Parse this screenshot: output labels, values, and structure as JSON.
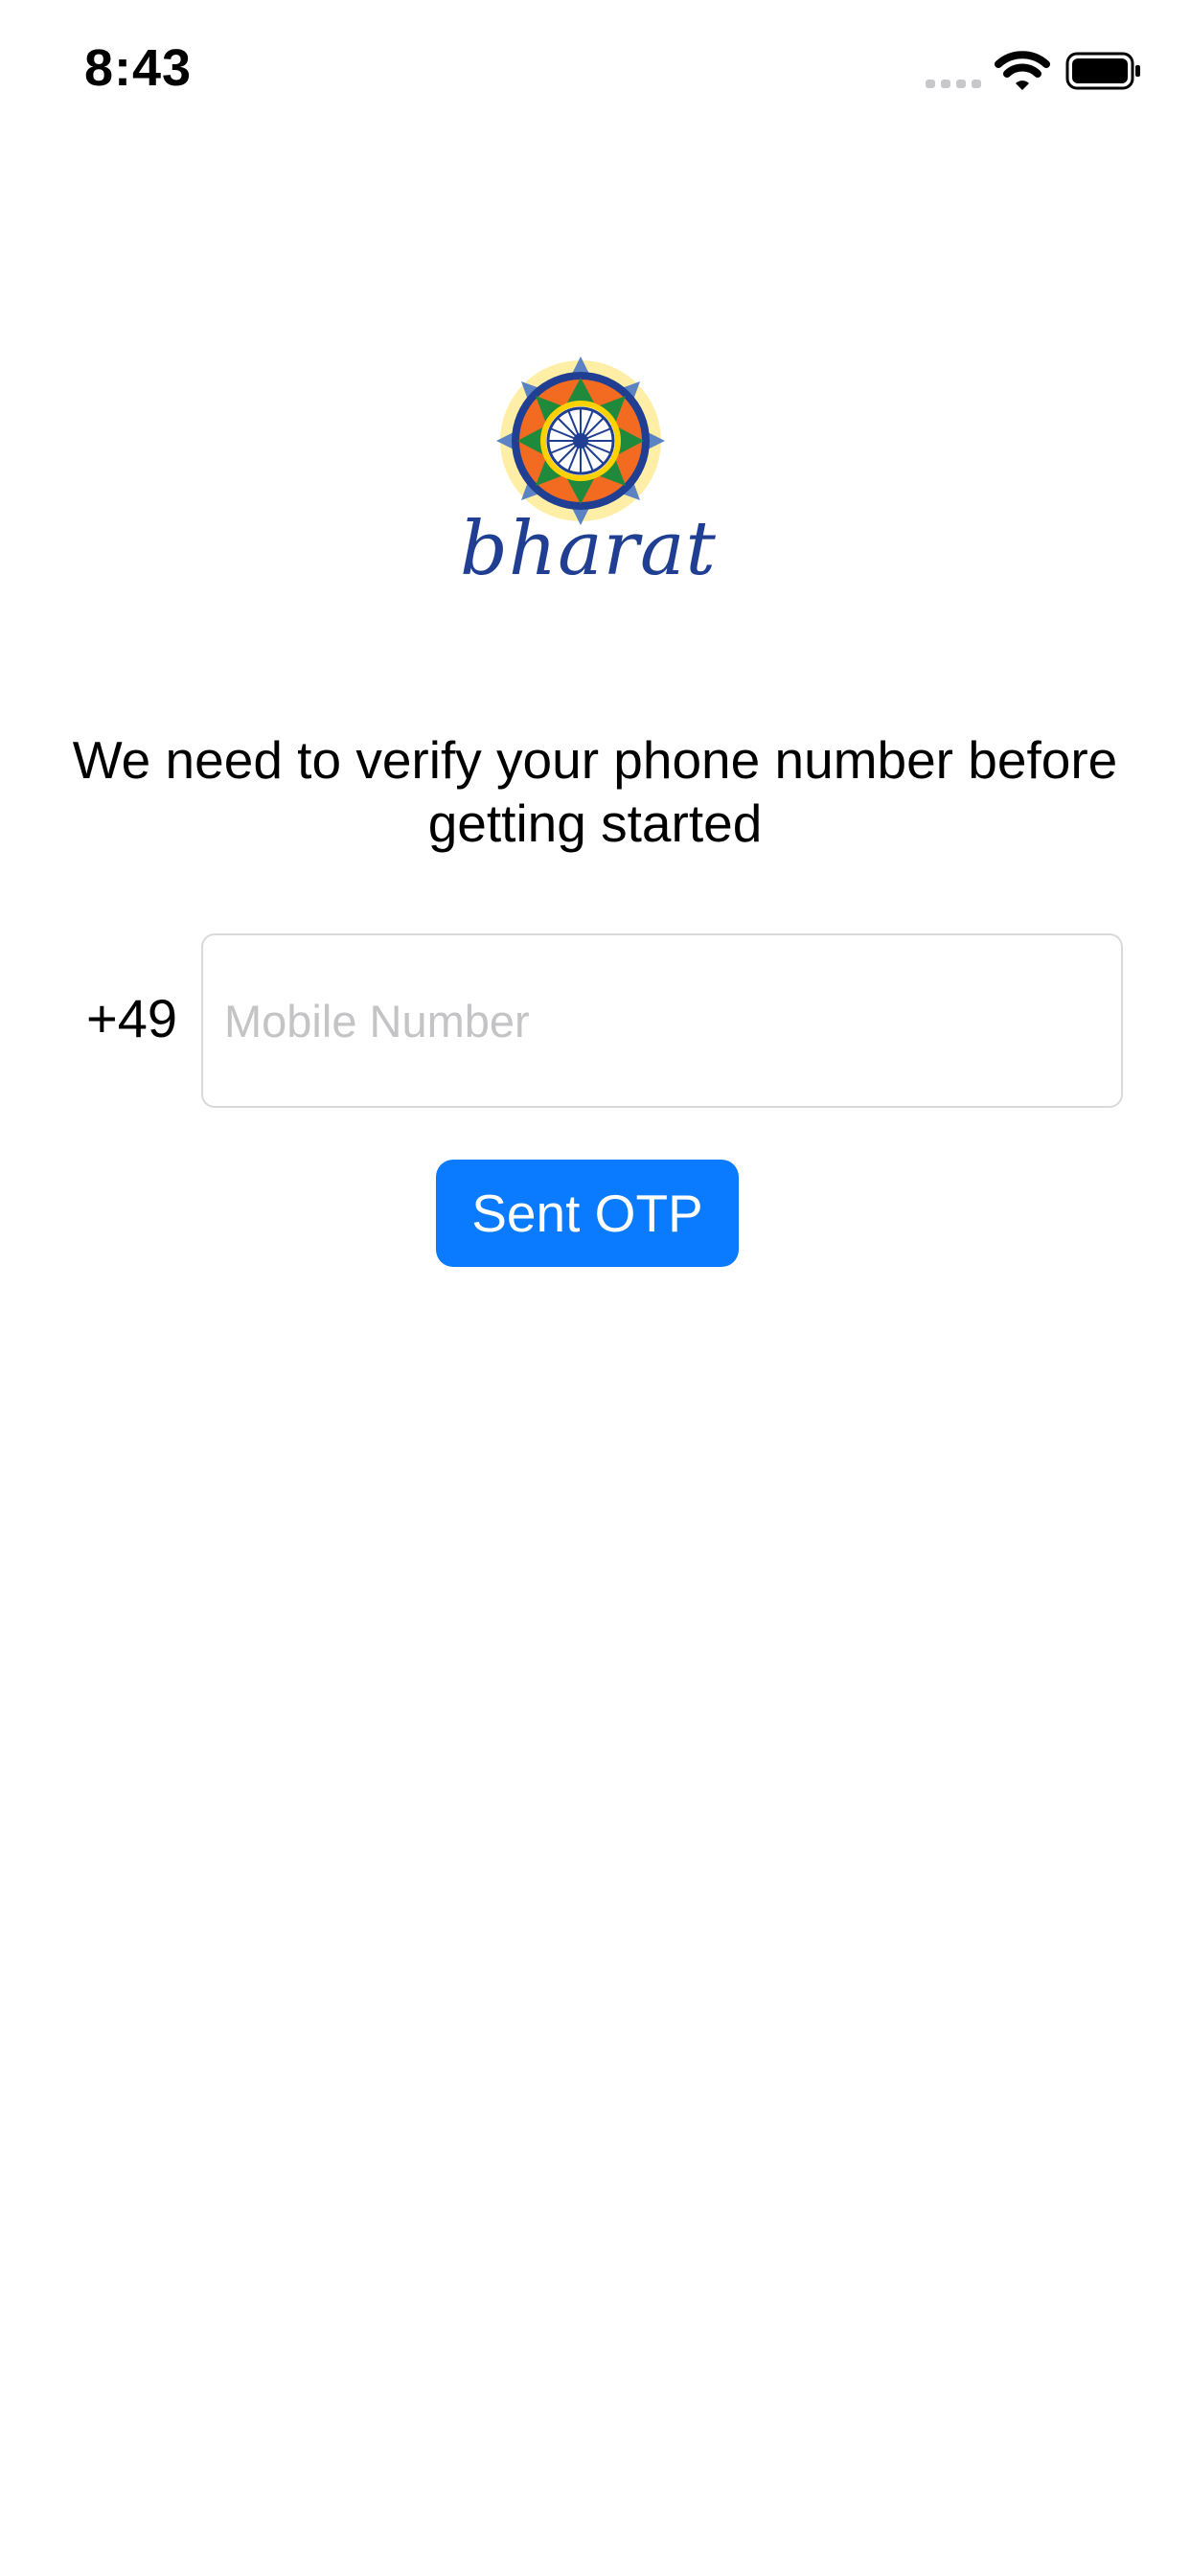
{
  "status_bar": {
    "time": "8:43",
    "icons": [
      "signal-icon",
      "wifi-icon",
      "battery-icon"
    ]
  },
  "logo": {
    "wordmark": "bharat",
    "color": "#213f92"
  },
  "message": "We need to verify your phone number before getting started",
  "phone": {
    "country_code": "+49",
    "value": "",
    "placeholder": "Mobile Number"
  },
  "send_button": {
    "label": "Sent OTP",
    "color": "#0a7aff"
  }
}
